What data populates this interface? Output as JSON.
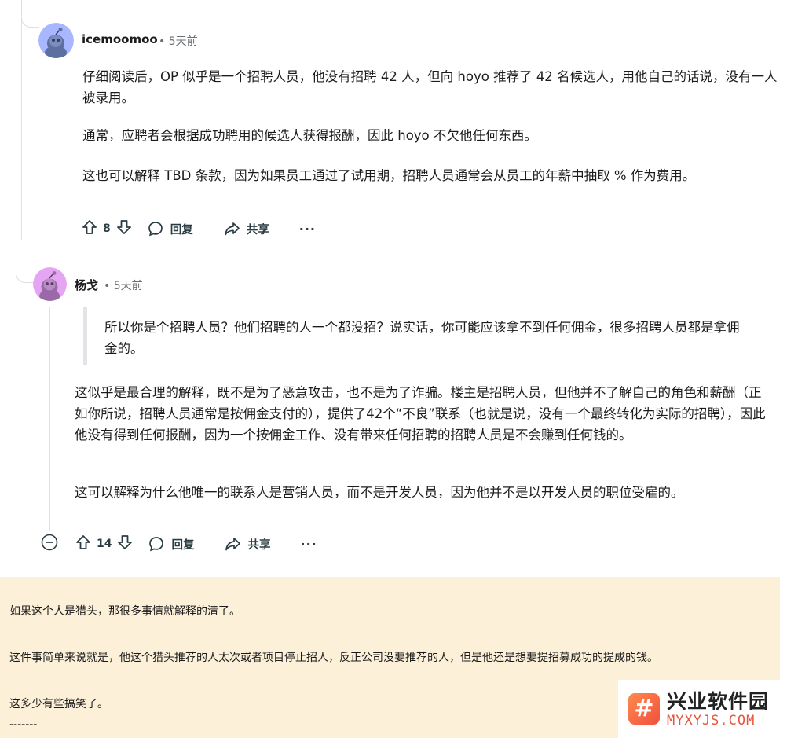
{
  "comments": [
    {
      "username": "icemoomoo",
      "meta": "• 5天前",
      "paragraphs": [
        "仔细阅读后，OP 似乎是一个招聘人员，他没有招聘 42 人，但向 hoyo 推荐了 42 名候选人，用他自己的话说，没有一人被录用。",
        "通常，应聘者会根据成功聘用的候选人获得报酬，因此 hoyo 不欠他任何东西。",
        "这也可以解释 TBD 条款，因为如果员工通过了试用期，招聘人员通常会从员工的年薪中抽取 % 作为费用。"
      ],
      "votes": "8",
      "reply_label": "回复",
      "share_label": "共享",
      "more_label": "···",
      "avatar_color": "#a8b7ff"
    },
    {
      "username": "杨戈",
      "meta": "• 5天前",
      "quote": "所以你是个招聘人员？他们招聘的人一个都没招？说实话，你可能应该拿不到任何佣金，很多招聘人员都是拿佣金的。",
      "paragraphs": [
        "这似乎是最合理的解释，既不是为了恶意攻击，也不是为了诈骗。楼主是招聘人员，但他并不了解自己的角色和薪酬（正如你所说，招聘人员通常是按佣金支付的），提供了42个“不良”联系（也就是说，没有一个最终转化为实际的招聘），因此他没有得到任何报酬，因为一个按佣金工作、没有带来任何招聘的招聘人员是不会赚到任何钱的。",
        "这可以解释为什么他唯一的联系人是营销人员，而不是开发人员，因为他并不是以开发人员的职位受雇的。"
      ],
      "votes": "14",
      "reply_label": "回复",
      "share_label": "共享",
      "more_label": "···",
      "avatar_color": "#e4a6f2"
    }
  ],
  "note": {
    "lines": [
      "如果这个人是猎头，那很多事情就解释的清了。",
      "这件事简单来说就是，他这个猎头推荐的人太次或者项目停止招人，反正公司没要推荐的人，但是他还是想要提招募成功的提成的钱。",
      "这多少有些搞笑了。",
      "-------"
    ],
    "background": "#fdf0d8"
  },
  "watermark": {
    "logo_glyph": "#",
    "name": "兴业软件园",
    "domain": "MYXYJS.COM",
    "accent": "#e8553e"
  },
  "colors": {
    "text": "#1c1c1c",
    "meta": "#6a6f74",
    "action": "#2a3c42",
    "thread_line": "#e0e2e5"
  }
}
